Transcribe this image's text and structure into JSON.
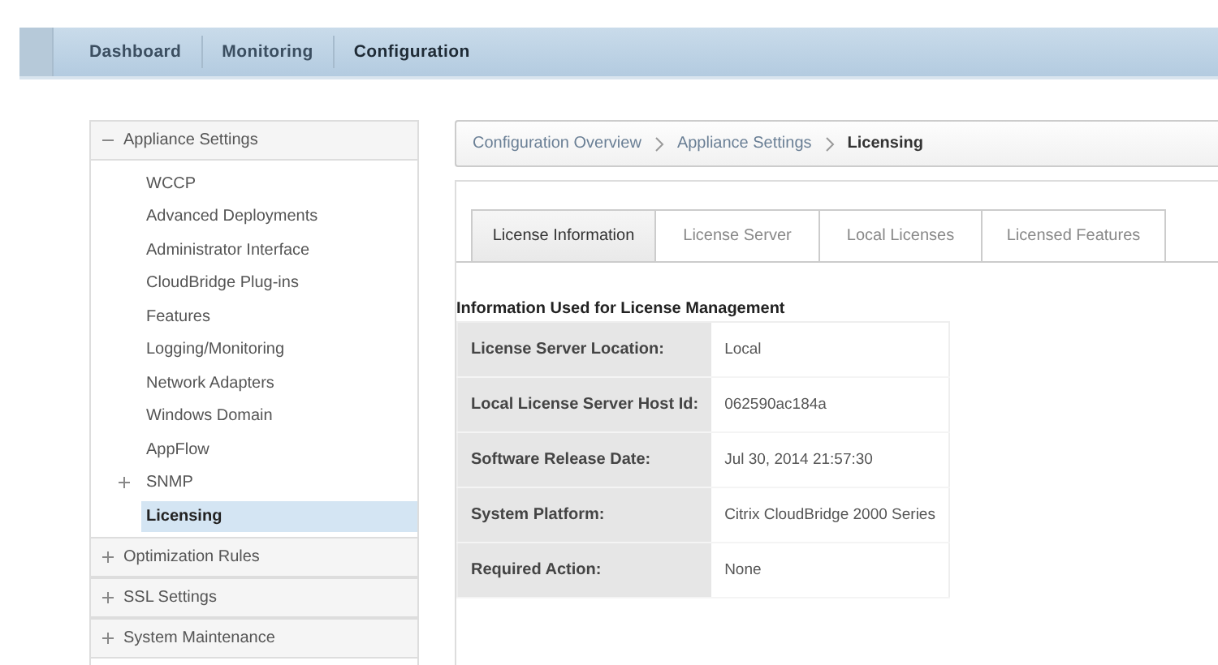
{
  "nav": {
    "tabs": [
      {
        "label": "Dashboard",
        "selected": false
      },
      {
        "label": "Monitoring",
        "selected": false
      },
      {
        "label": "Configuration",
        "selected": true
      }
    ]
  },
  "sidebar": {
    "sections": [
      {
        "label": "Appliance Settings",
        "expanded": true,
        "children": [
          {
            "label": "WCCP",
            "selected": false
          },
          {
            "label": "Advanced Deployments",
            "selected": false
          },
          {
            "label": "Administrator Interface",
            "selected": false
          },
          {
            "label": "CloudBridge Plug-ins",
            "selected": false
          },
          {
            "label": "Features",
            "selected": false
          },
          {
            "label": "Logging/Monitoring",
            "selected": false
          },
          {
            "label": "Network Adapters",
            "selected": false
          },
          {
            "label": "Windows Domain",
            "selected": false
          },
          {
            "label": "AppFlow",
            "selected": false
          },
          {
            "label": "SNMP",
            "selected": false,
            "expanded": false
          },
          {
            "label": "Licensing",
            "selected": true
          }
        ]
      },
      {
        "label": "Optimization Rules",
        "expanded": false
      },
      {
        "label": "SSL Settings",
        "expanded": false
      },
      {
        "label": "System Maintenance",
        "expanded": false
      }
    ]
  },
  "breadcrumb": [
    {
      "label": "Configuration Overview",
      "current": false
    },
    {
      "label": "Appliance Settings",
      "current": false
    },
    {
      "label": "Licensing",
      "current": true
    }
  ],
  "tabs": [
    {
      "label": "License Information",
      "selected": true
    },
    {
      "label": "License Server",
      "selected": false
    },
    {
      "label": "Local Licenses",
      "selected": false
    },
    {
      "label": "Licensed Features",
      "selected": false
    }
  ],
  "info": {
    "title": "Information Used for License Management",
    "rows": [
      {
        "label": "License Server Location:",
        "value": "Local"
      },
      {
        "label": "Local License Server Host Id:",
        "value": "062590ac184a"
      },
      {
        "label": "Software Release Date:",
        "value": "Jul 30, 2014 21:57:30"
      },
      {
        "label": "System Platform:",
        "value": "Citrix CloudBridge 2000 Series"
      },
      {
        "label": "Required Action:",
        "value": "None"
      }
    ]
  }
}
